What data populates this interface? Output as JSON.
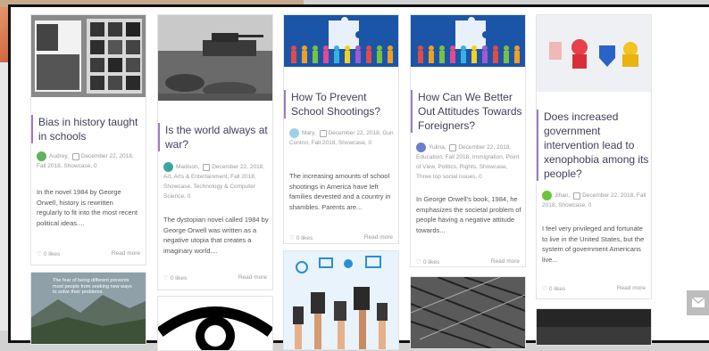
{
  "posts": [
    {
      "title": "Bias in history taught in schools",
      "author": "Audrey",
      "date": "December 22, 2018",
      "categories": "Fall 2018, Showcase, 0",
      "excerpt": "In the novel 1984 by George Orwell, history is rewritten regularly to fit into the most recent political ideas....",
      "likes": "0 likes",
      "read_more": "Read more",
      "image": "photo-collage"
    },
    {
      "title": "Is the world always at war?",
      "author": "Madison",
      "date": "December 22, 2018",
      "categories": "Art, Arts & Entertainment, Fall 2018, Showcase, Technology & Computer Science, 0",
      "excerpt": "The dystopian novel called 1984 by George Orwell was written as a negative utopia that creates a imaginary world....",
      "likes": "0 likes",
      "read_more": "Read more",
      "image": "war-photo"
    },
    {
      "title": "How To Prevent School Shootings?",
      "author": "Mary",
      "date": "December 22, 2018",
      "categories": "Gun Control, Fall 2018, Showcase, 0",
      "excerpt": "The increasing amounts of school shootings in America have left families devested and a country in shambles. Parents are...",
      "likes": "0 likes",
      "read_more": "Read more",
      "image": "puzzle-people"
    },
    {
      "title": "How Can We Better Out Attitudes Towards Foreigners?",
      "author": "Yulina",
      "date": "December 22, 2018",
      "categories": "Education, Fall 2018, Immigration, Point of View, Politics, Rights, Showcase, Three top social issues, 0",
      "excerpt": "In George Orwell's book, 1984, he emphasizes the societal problem of people having a negative attitude towards...",
      "likes": "0 likes",
      "read_more": "Read more",
      "image": "puzzle-people"
    },
    {
      "title": "Does increased government intervention lead to xenophobia among its people?",
      "author": "Jihan",
      "date": "December 22, 2018",
      "categories": "Fall 2018, Showcase, 0",
      "excerpt": "I feel very privileged and fortunate to live in the United States, but the system of government Americans live...",
      "likes": "0 likes",
      "read_more": "Read more",
      "image": "colored-pawns"
    }
  ],
  "bottom_row": [
    {
      "image": "mountains-quote",
      "caption": "The fear of being different prevents most people from seeking new ways to solve their problems."
    },
    {
      "image": "eye-icon"
    },
    {
      "image": "hands-devices"
    },
    {
      "image": "barbed-wire"
    },
    {
      "image": "dark-photo"
    }
  ],
  "colors": {
    "accent_border": "#9b7bc2",
    "title_text": "#3f3f5a",
    "meta_text": "#9a9a9a"
  },
  "icons": [
    "heart-icon",
    "comment-icon",
    "mail-icon"
  ]
}
